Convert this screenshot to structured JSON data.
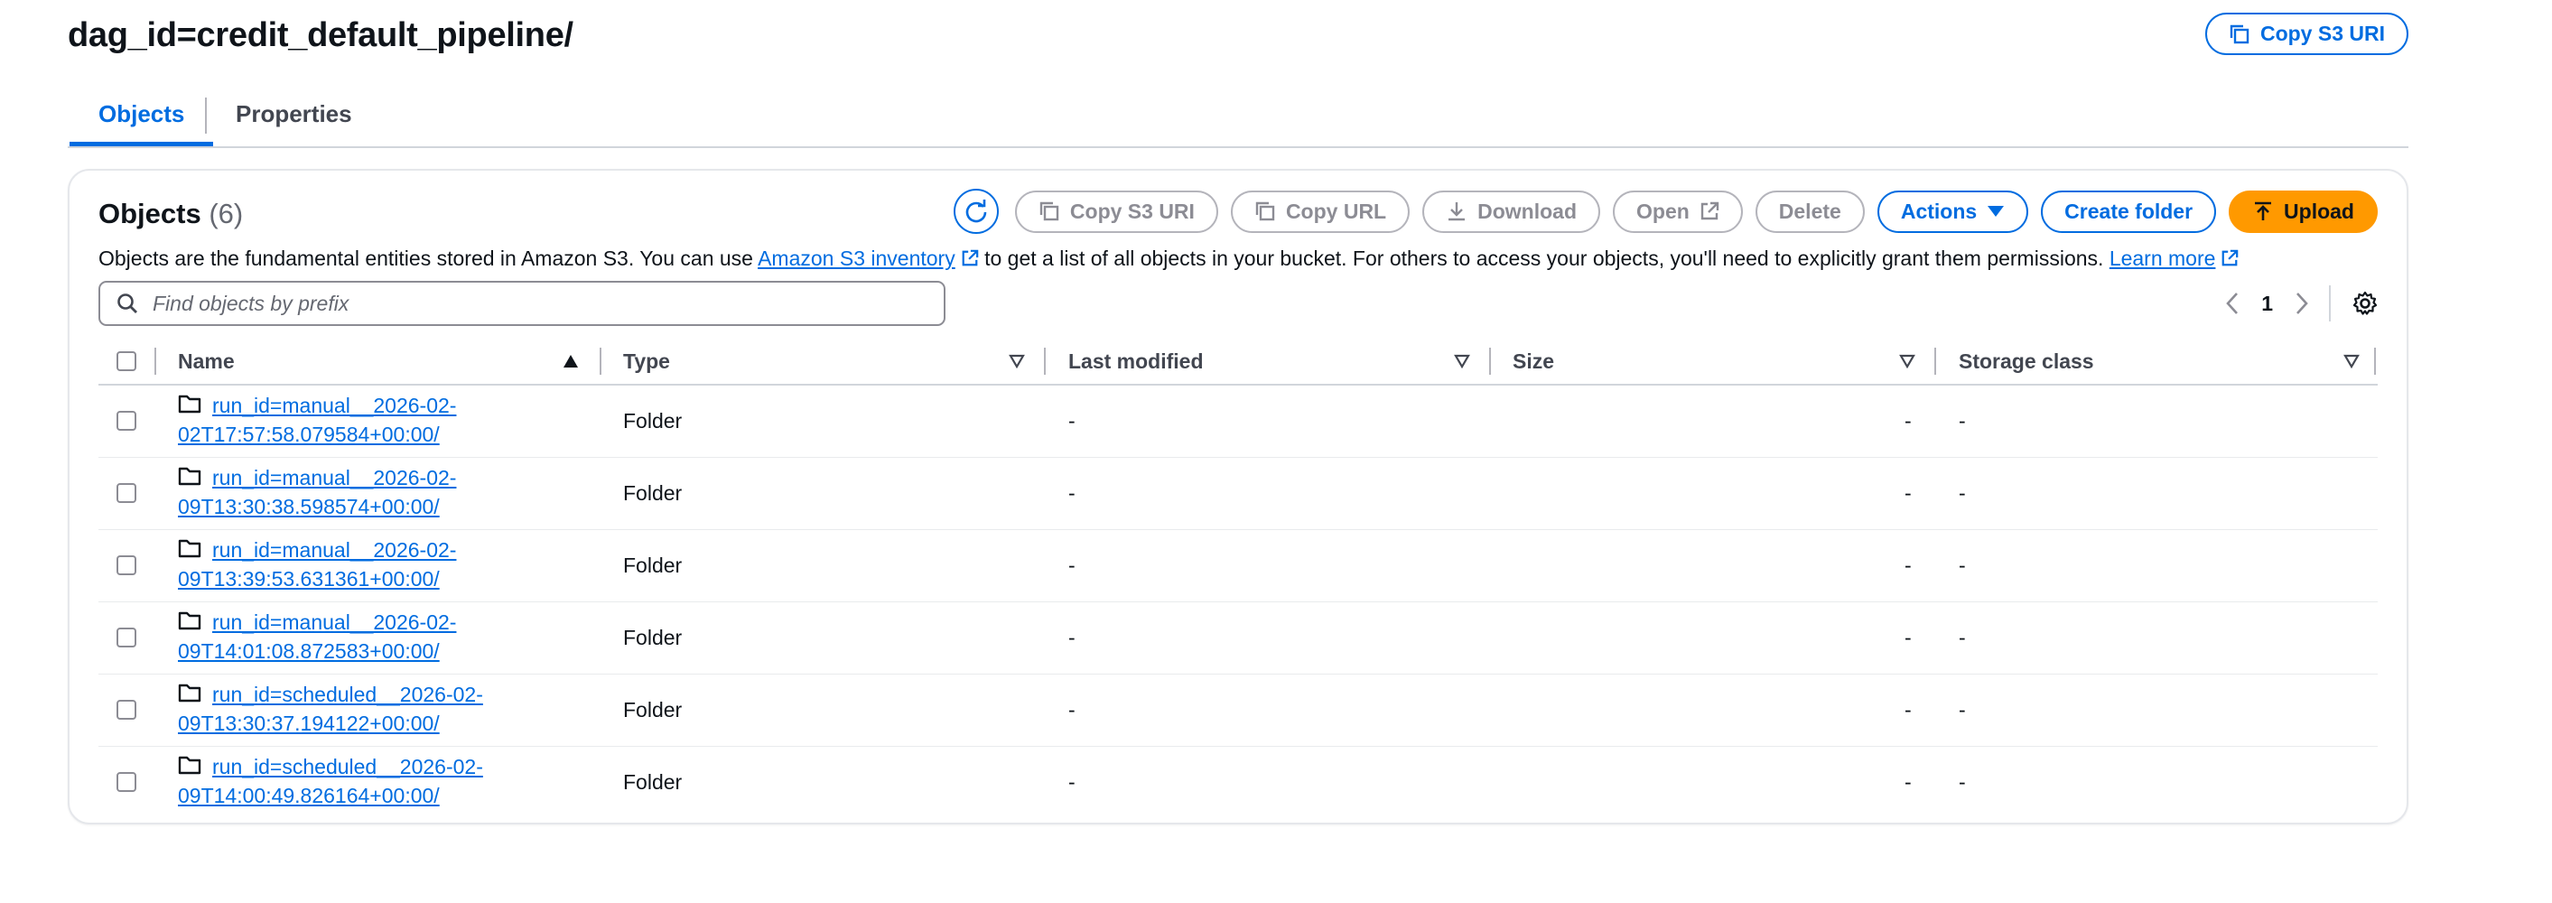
{
  "header": {
    "title": "dag_id=credit_default_pipeline/",
    "copy_s3_uri": "Copy S3 URI"
  },
  "tabs": [
    {
      "label": "Objects",
      "active": true
    },
    {
      "label": "Properties",
      "active": false
    }
  ],
  "objects_panel": {
    "title": "Objects",
    "count": "(6)",
    "toolbar": {
      "copy_s3_uri": "Copy S3 URI",
      "copy_url": "Copy URL",
      "download": "Download",
      "open": "Open",
      "delete": "Delete",
      "actions": "Actions",
      "create_folder": "Create folder",
      "upload": "Upload"
    },
    "description": {
      "part1": "Objects are the fundamental entities stored in Amazon S3. You can use ",
      "link1": "Amazon S3 inventory",
      "part2": " to get a list of all objects in your bucket. For others to access your objects, you'll need to explicitly grant them permissions. ",
      "link2": "Learn more"
    },
    "search": {
      "placeholder": "Find objects by prefix"
    },
    "pagination": {
      "current_page": "1"
    },
    "columns": {
      "name": "Name",
      "type": "Type",
      "last_modified": "Last modified",
      "size": "Size",
      "storage_class": "Storage class"
    },
    "rows": [
      {
        "name_line1": "run_id=manual__2026-02-",
        "name_line2": "02T17:57:58.079584+00:00/",
        "type": "Folder",
        "last_modified": "-",
        "size": "-",
        "storage_class": "-"
      },
      {
        "name_line1": "run_id=manual__2026-02-",
        "name_line2": "09T13:30:38.598574+00:00/",
        "type": "Folder",
        "last_modified": "-",
        "size": "-",
        "storage_class": "-"
      },
      {
        "name_line1": "run_id=manual__2026-02-",
        "name_line2": "09T13:39:53.631361+00:00/",
        "type": "Folder",
        "last_modified": "-",
        "size": "-",
        "storage_class": "-"
      },
      {
        "name_line1": "run_id=manual__2026-02-",
        "name_line2": "09T14:01:08.872583+00:00/",
        "type": "Folder",
        "last_modified": "-",
        "size": "-",
        "storage_class": "-"
      },
      {
        "name_line1": "run_id=scheduled__2026-02-",
        "name_line2": "09T13:30:37.194122+00:00/",
        "type": "Folder",
        "last_modified": "-",
        "size": "-",
        "storage_class": "-"
      },
      {
        "name_line1": "run_id=scheduled__2026-02-",
        "name_line2": "09T14:00:49.826164+00:00/",
        "type": "Folder",
        "last_modified": "-",
        "size": "-",
        "storage_class": "-"
      }
    ]
  },
  "colors": {
    "accent": "#006ce0",
    "upload_button": "#ff9900",
    "disabled": "#8c8c94"
  }
}
